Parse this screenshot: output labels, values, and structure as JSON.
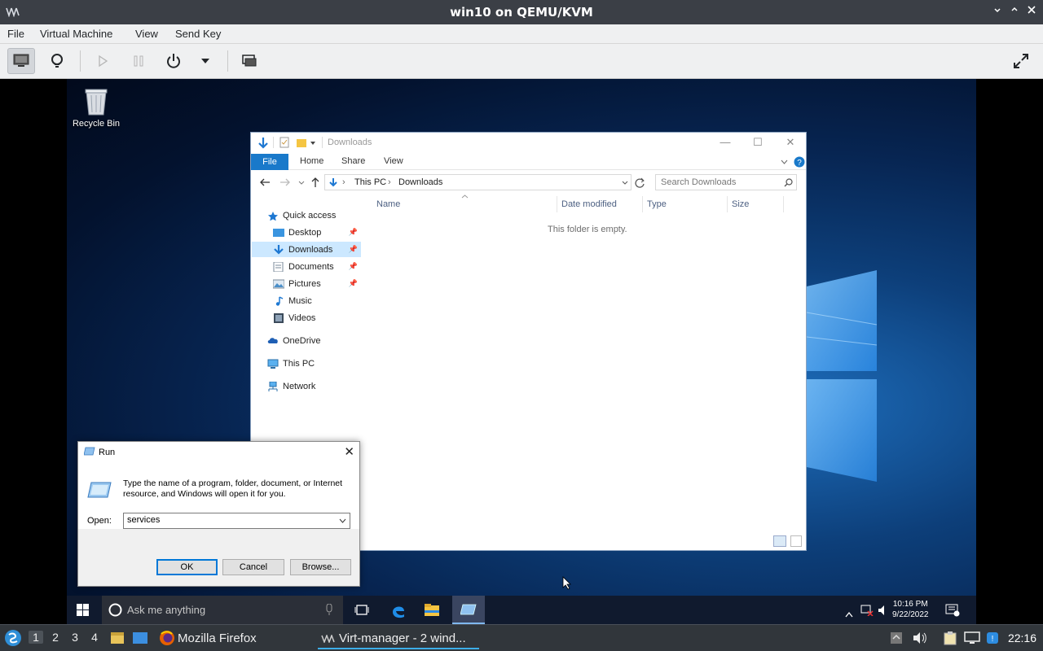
{
  "host_window": {
    "title": "win10 on QEMU/KVM",
    "menu": [
      "File",
      "Virtual Machine",
      "View",
      "Send Key"
    ]
  },
  "desktop": {
    "recycle_bin_label": "Recycle Bin"
  },
  "explorer": {
    "title": "Downloads",
    "ribbon_tabs": [
      "File",
      "Home",
      "Share",
      "View"
    ],
    "breadcrumb": [
      "This PC",
      "Downloads"
    ],
    "search_placeholder": "Search Downloads",
    "nav": {
      "quick_access": "Quick access",
      "desktop": "Desktop",
      "downloads": "Downloads",
      "documents": "Documents",
      "pictures": "Pictures",
      "music": "Music",
      "videos": "Videos",
      "onedrive": "OneDrive",
      "this_pc": "This PC",
      "network": "Network"
    },
    "columns": [
      "Name",
      "Date modified",
      "Type",
      "Size"
    ],
    "empty_message": "This folder is empty."
  },
  "run_dialog": {
    "title": "Run",
    "description": "Type the name of a program, folder, document, or Internet resource, and Windows will open it for you.",
    "open_label": "Open:",
    "open_value": "services",
    "ok_label": "OK",
    "cancel_label": "Cancel",
    "browse_label": "Browse..."
  },
  "win_taskbar": {
    "search_placeholder": "Ask me anything",
    "time": "10:16 PM",
    "date": "9/22/2022"
  },
  "host_taskbar": {
    "desktops": [
      "1",
      "2",
      "3",
      "4"
    ],
    "active_desktop": "1",
    "firefox_label": "Mozilla Firefox",
    "virtmanager_label": "Virt-manager - 2 wind...",
    "clock": "22:16"
  }
}
